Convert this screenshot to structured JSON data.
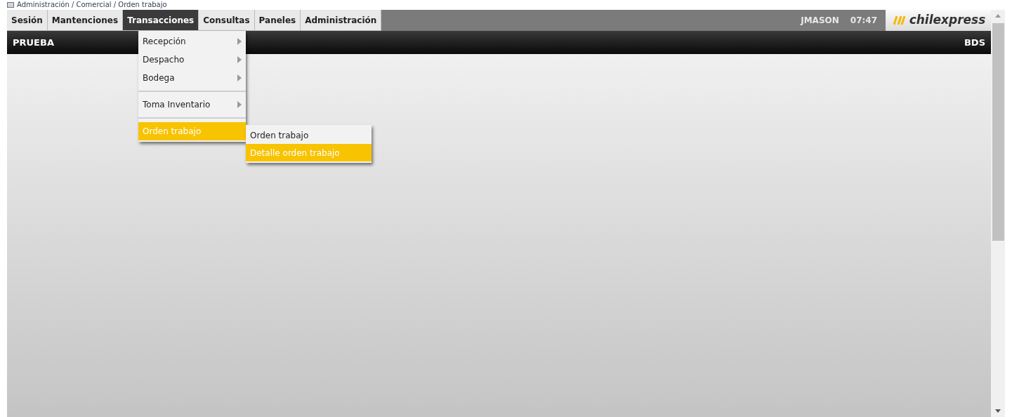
{
  "breadcrumb": "Administración / Comercial / Orden trabajo",
  "menu": [
    {
      "label": "Sesión",
      "selected": false
    },
    {
      "label": "Mantenciones",
      "selected": false
    },
    {
      "label": "Transacciones",
      "selected": true
    },
    {
      "label": "Consultas",
      "selected": false
    },
    {
      "label": "Paneles",
      "selected": false
    },
    {
      "label": "Administración",
      "selected": false
    }
  ],
  "user": "JMASON",
  "time": "07:47",
  "logo": "chilexpress",
  "header": {
    "left": "PRUEBA",
    "right": "BDS"
  },
  "dropdown": [
    {
      "kind": "item",
      "label": "Recepción",
      "has_submenu": true,
      "selected": false
    },
    {
      "kind": "item",
      "label": "Despacho",
      "has_submenu": true,
      "selected": false
    },
    {
      "kind": "item",
      "label": "Bodega",
      "has_submenu": true,
      "selected": false
    },
    {
      "kind": "separator"
    },
    {
      "kind": "item",
      "label": "Toma Inventario",
      "has_submenu": true,
      "selected": false
    },
    {
      "kind": "separator"
    },
    {
      "kind": "item",
      "label": "Orden trabajo",
      "has_submenu": false,
      "selected": true
    }
  ],
  "submenu": [
    {
      "label": "Orden trabajo",
      "selected": false
    },
    {
      "label": "Detalle orden trabajo",
      "selected": true
    }
  ]
}
